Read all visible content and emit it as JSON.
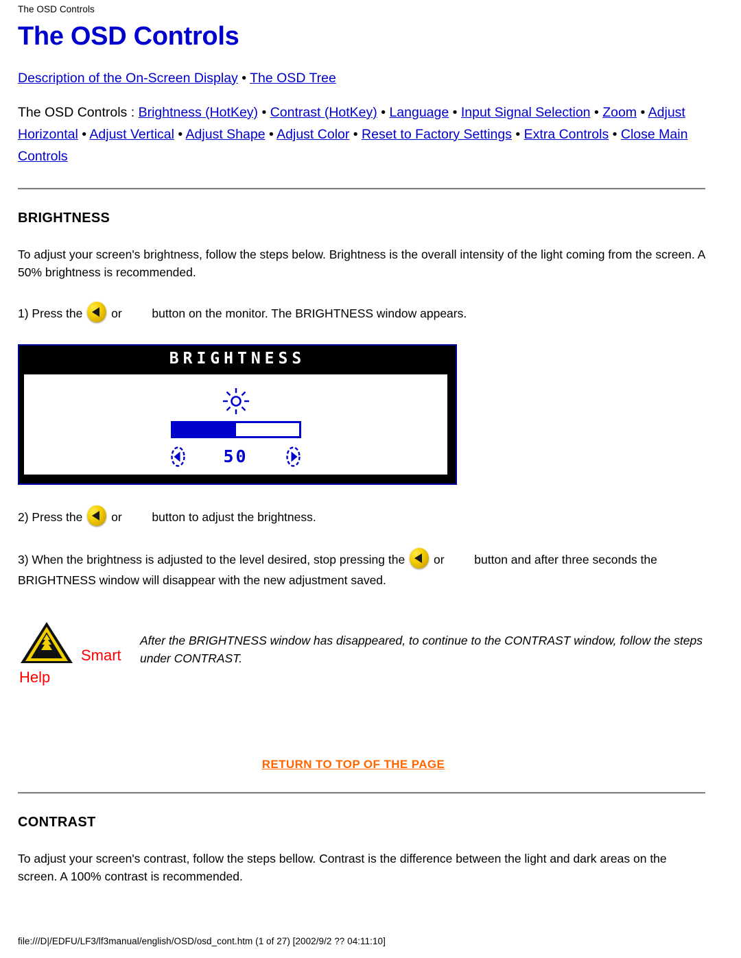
{
  "browser": {
    "header_title": "The OSD Controls",
    "footer_path": "file:///D|/EDFU/LF3/lf3manual/english/OSD/osd_cont.htm (1 of 27) [2002/9/2 ?? 04:11:10]"
  },
  "page": {
    "title": "The OSD Controls"
  },
  "nav": {
    "line1": {
      "links": [
        "Description of the On-Screen Display",
        "The OSD Tree"
      ],
      "separator": " • "
    },
    "line2": {
      "prefix": "The OSD Controls : ",
      "links": [
        "Brightness (HotKey)",
        "Contrast (HotKey)",
        "Language",
        "Input Signal Selection",
        "Zoom",
        "Adjust Horizontal",
        "Adjust Vertical",
        "Adjust Shape",
        "Adjust Color",
        "Reset to Factory Settings",
        "Extra Controls",
        "Close Main Controls"
      ],
      "separator": " • "
    }
  },
  "brightness": {
    "heading": "BRIGHTNESS",
    "intro": "To adjust your screen's brightness, follow the steps below. Brightness is the overall intensity of the light coming from the screen. A 50% brightness is recommended.",
    "step1_a": "1) Press the",
    "step1_or": "or",
    "step1_b": "button on the monitor. The BRIGHTNESS window appears.",
    "step2_a": "2) Press the",
    "step2_or": "or",
    "step2_b": "button to adjust the brightness.",
    "step3_a": "3) When the brightness is adjusted to the level desired, stop pressing the",
    "step3_or": "or",
    "step3_b": "button and after three seconds the BRIGHTNESS window will disappear with the new adjustment saved."
  },
  "osd_window": {
    "title": "BRIGHTNESS",
    "value": "50",
    "fill_percent": 50,
    "icon": "sun-icon",
    "left_arrow": "left-arrow-icon",
    "right_arrow": "right-arrow-icon"
  },
  "note": {
    "icon": "warning-triangle-icon",
    "label_line1": "Smart",
    "label_line2": "Help",
    "text": "After the BRIGHTNESS window has disappeared, to continue to the CONTRAST window, follow the steps under CONTRAST."
  },
  "return_top": {
    "label": "RETURN TO TOP OF THE PAGE"
  },
  "contrast": {
    "heading": "CONTRAST",
    "intro": "To adjust your screen's contrast, follow the steps bellow. Contrast is the difference between the light and dark areas on the screen. A 100% contrast is recommended."
  },
  "colors": {
    "link": "#0000CC",
    "heading": "#0000CC",
    "return_top": "#FF6600",
    "note_label": "#FF0000",
    "osd_blue": "#0000CC",
    "button_yellow": "#F5D000"
  }
}
